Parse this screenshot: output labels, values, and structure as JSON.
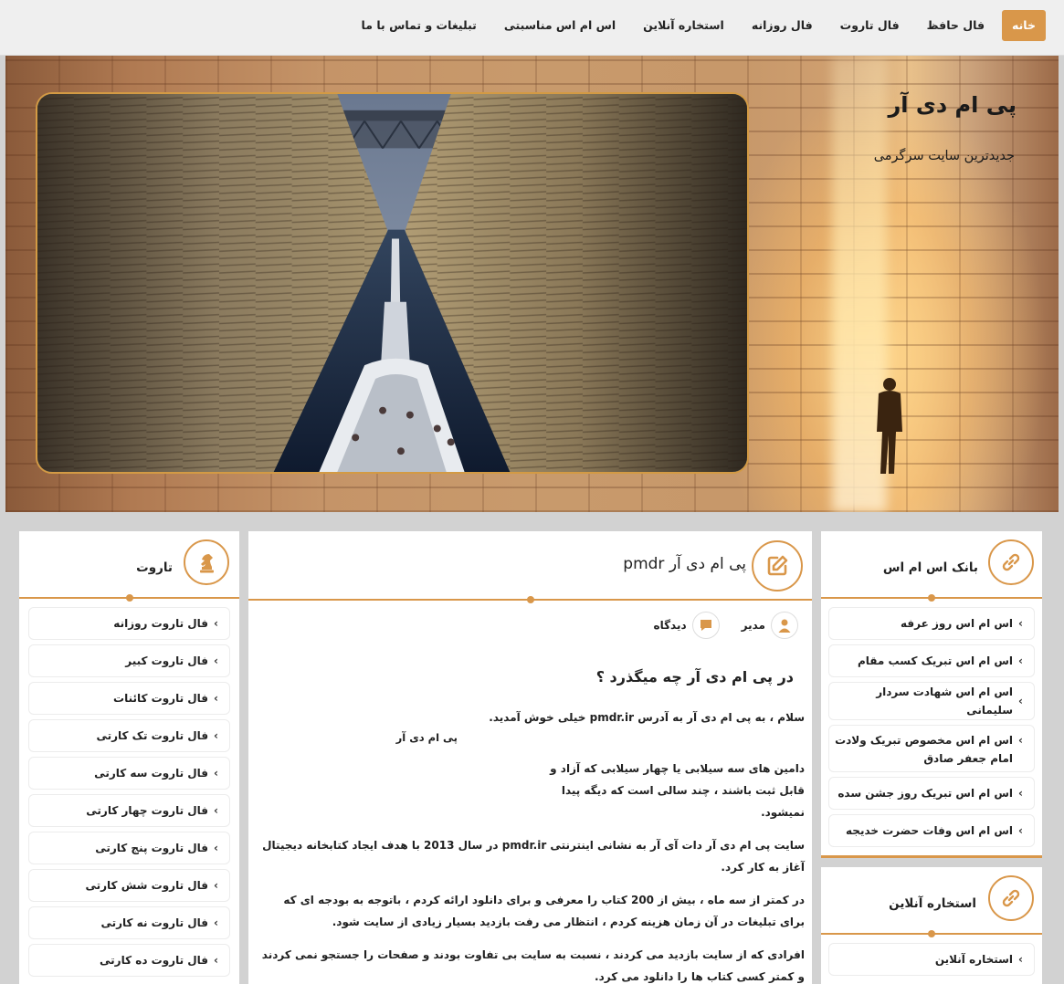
{
  "nav": {
    "items": [
      {
        "label": "خانه",
        "active": true
      },
      {
        "label": "فال حافظ"
      },
      {
        "label": "فال تاروت"
      },
      {
        "label": "فال روزانه"
      },
      {
        "label": "استخاره آنلاین"
      },
      {
        "label": "اس ام اس مناسبتی"
      },
      {
        "label": "تبلیغات و تماس با ما"
      }
    ]
  },
  "header": {
    "site_title": "پی ام دی آر",
    "tagline": "جدیدترین سایت سرگرمی"
  },
  "sms_widget": {
    "title": "بانک اس ام اس",
    "icon": "link-icon",
    "items": [
      "اس ام اس روز عرفه",
      "اس ام اس تبریک کسب مقام",
      "اس ام اس شهادت سردار سلیمانی",
      "اس ام اس مخصوص تبریک ولادت امام جعفر صادق",
      "اس ام اس تبریک روز جشن سده",
      "اس ام اس وفات حضرت خدیجه"
    ]
  },
  "estekhare_widget": {
    "title": "استخاره آنلاین",
    "icon": "link-icon",
    "items": [
      "استخاره آنلاین"
    ]
  },
  "post": {
    "icon": "edit-icon",
    "title": "پی ام دی آر pmdr",
    "author": "مدیر",
    "comments": "دیدگاه",
    "heading": "در پی ام دی آر چه میگذرد ؟",
    "p1": "سلام ، به پی ام دی آر به آدرس pmdr.ir خیلی خوش آمدید.",
    "slogan": "پی ام دی آر",
    "p2": "دامین های سه سیلابی یا چهار سیلابی که آزاد و قابل ثبت باشند ، چند سالی است که دیگه پیدا نمیشود.",
    "p3": "سایت پی ام دی آر دات آی آر به نشانی اینترنتی pmdr.ir در سال 2013 با هدف ایجاد کتابخانه دیجیتال آغاز به کار کرد.",
    "p4": "در کمتر از سه ماه ، بیش از 200 کتاب را معرفی و برای دانلود ارائه کردم ، باتوجه به بودجه ای که برای تبلیغات در آن زمان هزینه کردم ، انتظار می رفت بازدید بسیار زیادی از سایت شود.",
    "p5": "افرادی که از سایت بازدید می کردند ، نسبت به سایت بی تفاوت بودند و صفحات را جستجو نمی کردند و کمتر کسی کتاب ها را دانلود می کرد."
  },
  "tarot_widget": {
    "title": "تاروت",
    "icon": "chess-knight-icon",
    "items": [
      "فال تاروت روزانه",
      "فال تاروت کبیر",
      "فال تاروت کائنات",
      "فال تاروت تک کارتی",
      "فال تاروت سه کارتی",
      "فال تاروت چهار کارتی",
      "فال تاروت پنج کارتی",
      "فال تاروت شش کارتی",
      "فال تاروت نه کارتی",
      "فال تاروت ده کارتی"
    ]
  },
  "colors": {
    "accent": "#d9974a",
    "nav_bg": "#efefef",
    "page_bg": "#d2d2d2"
  }
}
